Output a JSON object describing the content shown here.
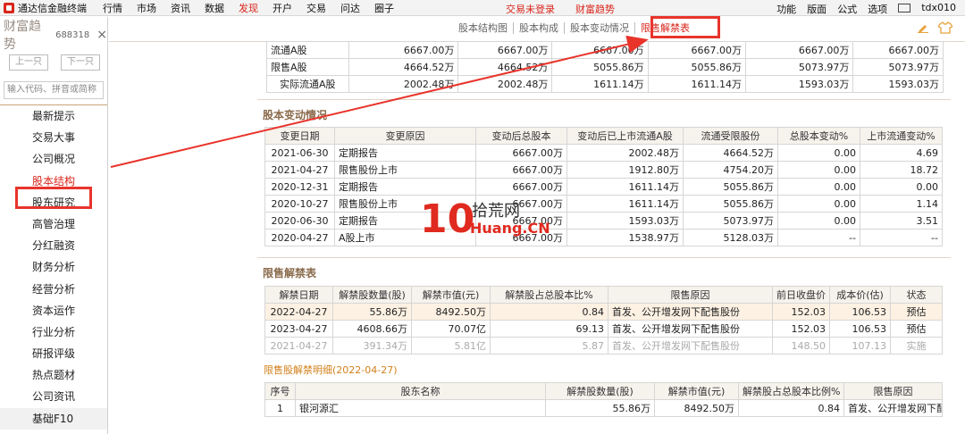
{
  "menubar": {
    "app_title": "通达信金融终端",
    "items": [
      "行情",
      "市场",
      "资讯",
      "数据",
      "发现",
      "开户",
      "交易",
      "问达",
      "圈子"
    ],
    "active_index": 4,
    "notice_login": "交易未登录",
    "notice_trend": "财富趋势",
    "right_items": [
      "功能",
      "版面",
      "公式",
      "选项"
    ],
    "user": "tdx010"
  },
  "sidebar": {
    "title": "财富趋势",
    "code": "688318",
    "close": "×",
    "prev": "上一只",
    "next": "下一只",
    "search_placeholder": "输入代码、拼音或简称",
    "items": [
      "最新提示",
      "交易大事",
      "公司概况",
      "股本结构",
      "股东研究",
      "高管治理",
      "分红融资",
      "财务分析",
      "经营分析",
      "资本运作",
      "行业分析",
      "研报评级",
      "热点题材",
      "公司资讯",
      "基础F10"
    ],
    "active_index": 3
  },
  "tabs": {
    "items": [
      "股本结构图",
      "股本构成",
      "股本变动情况",
      "限售解禁表"
    ],
    "active_index": 3
  },
  "top_table": {
    "rows": [
      {
        "label": "流通A股",
        "values": [
          "6667.00万",
          "6667.00万",
          "6667.00万",
          "6667.00万",
          "6667.00万",
          "6667.00万"
        ]
      },
      {
        "label": "限售A股",
        "values": [
          "4664.52万",
          "4664.52万",
          "5055.86万",
          "5055.86万",
          "5073.97万",
          "5073.97万"
        ]
      },
      {
        "label": "实际流通A股",
        "values": [
          "2002.48万",
          "2002.48万",
          "1611.14万",
          "1611.14万",
          "1593.03万",
          "1593.03万"
        ]
      }
    ]
  },
  "change_section": {
    "title": "股本变动情况",
    "headers": [
      "变更日期",
      "变更原因",
      "变动后总股本",
      "变动后已上市流通A股",
      "流通受限股份",
      "总股本变动%",
      "上市流通变动%"
    ],
    "rows": [
      [
        "2021-06-30",
        "定期报告",
        "6667.00万",
        "2002.48万",
        "4664.52万",
        "0.00",
        "4.69"
      ],
      [
        "2021-04-27",
        "限售股份上市",
        "6667.00万",
        "1912.80万",
        "4754.20万",
        "0.00",
        "18.72"
      ],
      [
        "2020-12-31",
        "定期报告",
        "6667.00万",
        "1611.14万",
        "5055.86万",
        "0.00",
        "0.00"
      ],
      [
        "2020-10-27",
        "限售股份上市",
        "6667.00万",
        "1611.14万",
        "5055.86万",
        "0.00",
        "1.14"
      ],
      [
        "2020-06-30",
        "定期报告",
        "6667.00万",
        "1593.03万",
        "5073.97万",
        "0.00",
        "3.51"
      ],
      [
        "2020-04-27",
        "A股上市",
        "6667.00万",
        "1538.97万",
        "5128.03万",
        "--",
        "--"
      ]
    ]
  },
  "jiejin_section": {
    "title": "限售解禁表",
    "headers": [
      "解禁日期",
      "解禁股数量(股)",
      "解禁市值(元)",
      "解禁股占总股本比%",
      "限售原因",
      "前日收盘价",
      "成本价(估)",
      "状态"
    ],
    "rows": [
      [
        "2022-04-27",
        "55.86万",
        "8492.50万",
        "0.84",
        "首发、公开增发网下配售股份",
        "152.03",
        "106.53",
        "预估"
      ],
      [
        "2023-04-27",
        "4608.66万",
        "70.07亿",
        "69.13",
        "首发、公开增发网下配售股份",
        "152.03",
        "106.53",
        "预估"
      ],
      [
        "2021-04-27",
        "391.34万",
        "5.81亿",
        "5.87",
        "首发、公开增发网下配售股份",
        "148.50",
        "107.13",
        "实施"
      ]
    ]
  },
  "detail_section": {
    "title": "限售股解禁明细(2022-04-27)",
    "headers": [
      "序号",
      "股东名称",
      "解禁股数量(股)",
      "解禁市值(元)",
      "解禁股占总股本比例%",
      "限售原因"
    ],
    "rows": [
      [
        "1",
        "银河源汇",
        "55.86万",
        "8492.50万",
        "0.84",
        "首发、公开增发网下配售股份"
      ]
    ]
  },
  "watermark": {
    "num": "10",
    "cn": "拾荒网",
    "en": "Huang.CN"
  },
  "colors": {
    "accent_red": "#d8261c",
    "section_brown": "#8a6a4b",
    "subtitle_orange": "#d2801c"
  }
}
